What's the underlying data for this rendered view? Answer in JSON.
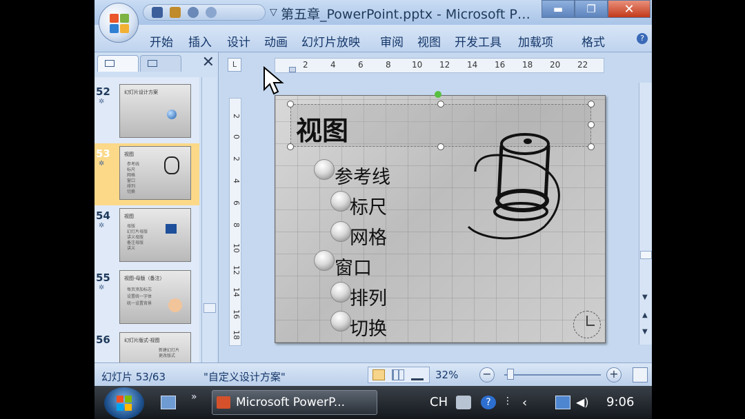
{
  "window": {
    "title": "第五章_PowerPoint.pptx - Microsoft P…",
    "minimize": "▬",
    "maximize": "❐",
    "close": "✕",
    "qat_separator": "▽"
  },
  "ribbon": {
    "tabs": [
      "开始",
      "插入",
      "设计",
      "动画",
      "幻灯片放映",
      "审阅",
      "视图",
      "开发工具",
      "加载项",
      "格式"
    ],
    "help": "?"
  },
  "slides_pane": {
    "close": "✕",
    "thumbnails": [
      {
        "number": "52",
        "title": "幻灯片设计方案",
        "lines": []
      },
      {
        "number": "53",
        "title": "视图",
        "lines": [
          "参考线",
          "标尺",
          "网格",
          "窗口",
          "排列",
          "切换"
        ]
      },
      {
        "number": "54",
        "title": "视图",
        "lines": [
          "母版",
          "幻灯片母版",
          "讲义母版",
          "备注母版",
          "讲义"
        ]
      },
      {
        "number": "55",
        "title": "视图-母版（备注）",
        "lines": [
          "每页添加标志",
          "设置统一字体",
          "统一设置背景"
        ]
      },
      {
        "number": "56",
        "title": "幻灯片版式-视图",
        "lines": [
          "新建幻灯片",
          "更改版式"
        ]
      }
    ],
    "star": "✲"
  },
  "rulers": {
    "horizontal": [
      "2",
      "4",
      "6",
      "8",
      "10",
      "12",
      "14",
      "16",
      "18",
      "20",
      "22"
    ],
    "vertical": [
      "2",
      "0",
      "2",
      "4",
      "6",
      "8",
      "10",
      "12",
      "14",
      "16",
      "18"
    ],
    "corner": "L"
  },
  "slide": {
    "title": "视图",
    "bullets": [
      {
        "text": "参考线",
        "level": 1
      },
      {
        "text": "标尺",
        "level": 2
      },
      {
        "text": "网格",
        "level": 2
      },
      {
        "text": "窗口",
        "level": 1
      },
      {
        "text": "排列",
        "level": 2
      },
      {
        "text": "切换",
        "level": 2
      }
    ]
  },
  "status_bar": {
    "slide_count": "幻灯片 53/63",
    "theme": "\"自定义设计方案\"",
    "zoom": "32%",
    "zoom_out": "−",
    "zoom_in": "+"
  },
  "taskbar": {
    "task_label": "Microsoft PowerP...",
    "chevron": "»",
    "language": "CH",
    "time": "9:06"
  }
}
